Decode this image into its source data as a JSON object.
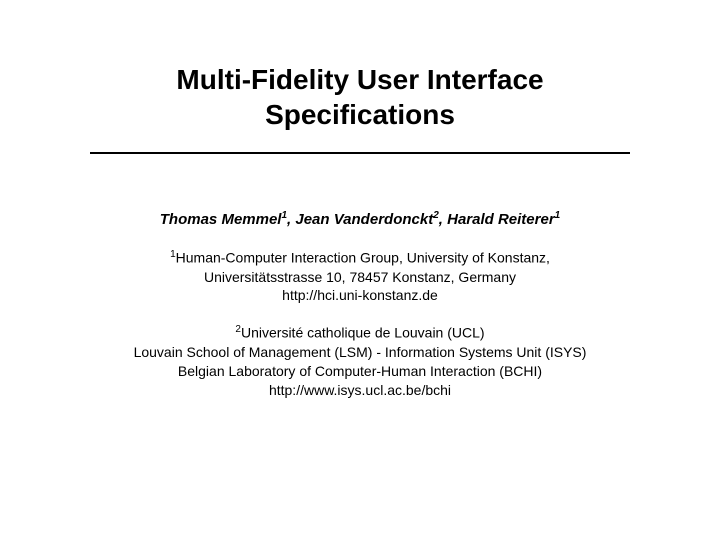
{
  "title_line1": "Multi-Fidelity User Interface",
  "title_line2": "Specifications",
  "authors": {
    "a1_name": "Thomas Memmel",
    "a1_sup": "1",
    "a2_name": "Jean Vanderdonckt",
    "a2_sup": "2",
    "a3_name": "Harald Reiterer",
    "a3_sup": "1"
  },
  "affil1": {
    "sup": "1",
    "line1_rest": "Human-Computer Interaction Group, University of Konstanz,",
    "line2": "Universitätsstrasse 10, 78457 Konstanz, Germany",
    "line3": "http://hci.uni-konstanz.de"
  },
  "affil2": {
    "sup": "2",
    "line1_rest": "Université catholique de Louvain (UCL)",
    "line2": "Louvain School of Management (LSM) - Information Systems Unit (ISYS)",
    "line3": "Belgian Laboratory of Computer-Human Interaction (BCHI)",
    "line4": "http://www.isys.ucl.ac.be/bchi"
  }
}
